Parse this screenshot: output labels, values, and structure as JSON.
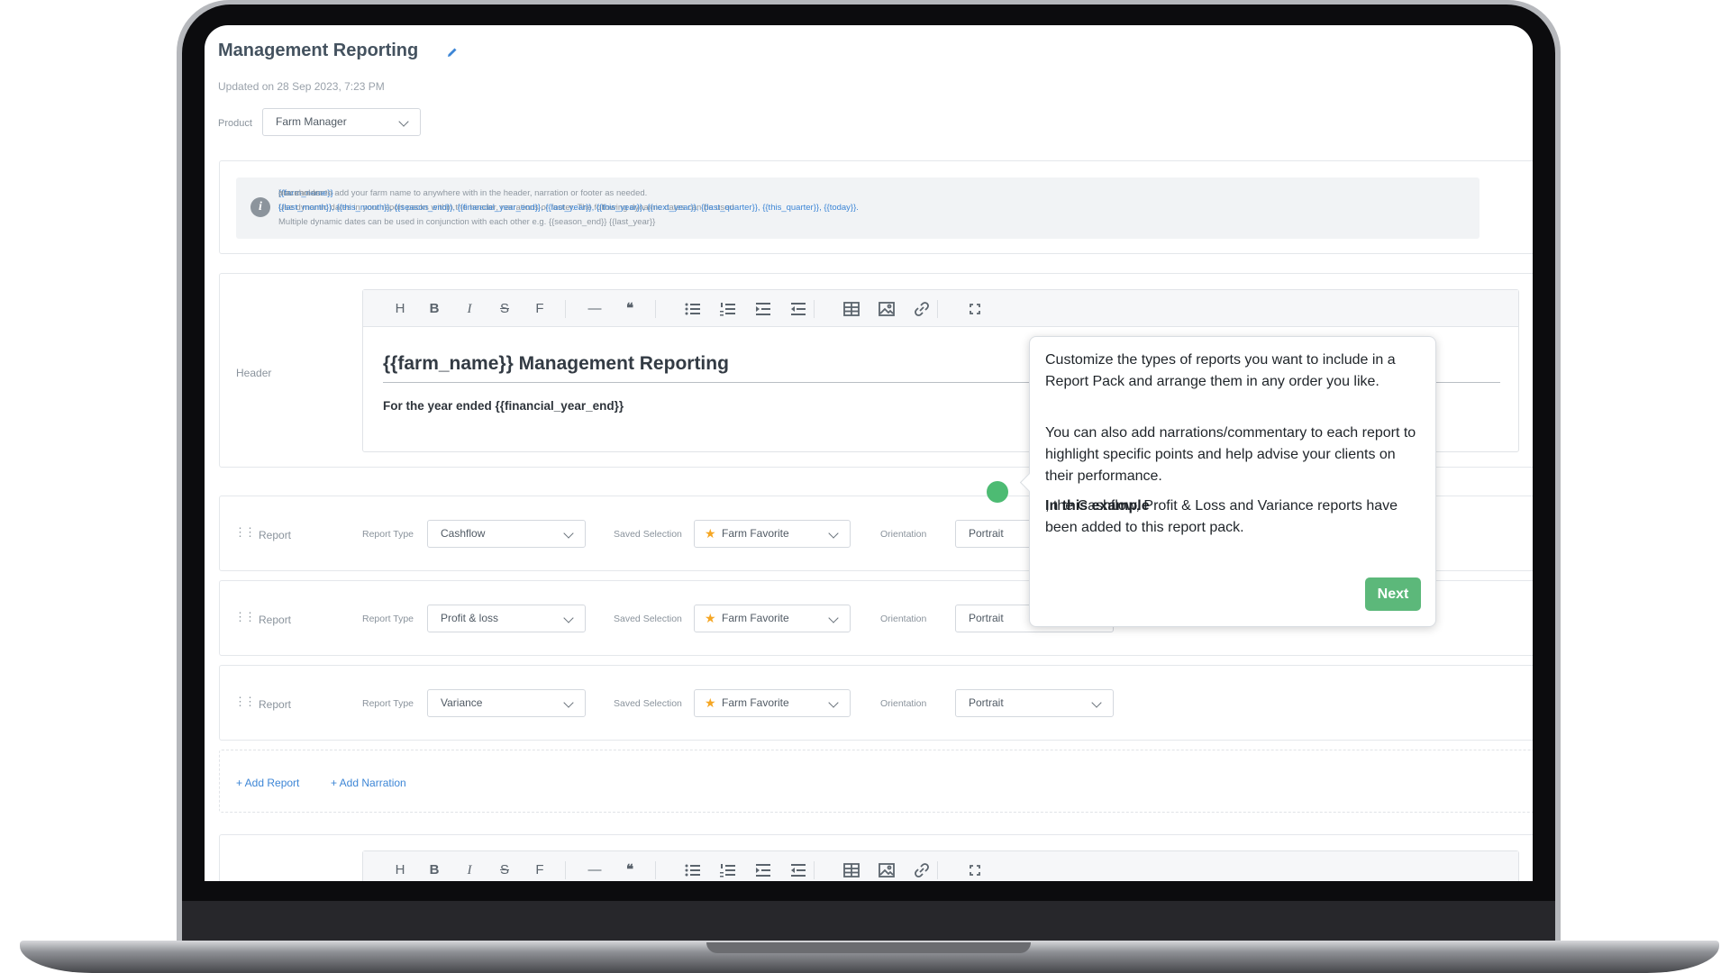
{
  "page": {
    "title": "Management Reporting",
    "updated": "Updated on 28 Sep 2023, 7:23 PM",
    "product_label": "Product",
    "product_value": "Farm Manager"
  },
  "info": {
    "line1_a": "You can use ",
    "line1_ph": "{{farm_name}}",
    "line1_b": " placeholder to add your farm name to anywhere with in the header, narration or footer as needed.",
    "line2_a": "Use dynamic dates in your report packs within the header, narrations or footer. The following dynamic dates can be used ",
    "line2_ph": "{{last_month}}, {{this_month}}, {{season_end}}, {{financial_year_end}}, {{last_year}}, {{this_year}}, {{next_year}}, {{last_quarter}}, {{this_quarter}}, {{today}}.",
    "line3": "Multiple dynamic dates can be used in conjunction with each other e.g. {{season_end}} {{last_year}}"
  },
  "header_section": {
    "label": "Header",
    "editor_title": "{{farm_name}} Management Reporting",
    "editor_subtitle": "For the year ended {{financial_year_end}}"
  },
  "toolbar": {
    "icons": [
      "heading-icon",
      "bold-icon",
      "italic-icon",
      "strikethrough-icon",
      "font-icon",
      "horizontal-rule-icon",
      "quote-icon",
      "bullet-list-icon",
      "numbered-list-icon",
      "indent-icon",
      "outdent-icon",
      "table-icon",
      "image-icon",
      "link-icon",
      "fullscreen-icon"
    ],
    "heading": "H",
    "bold": "B",
    "italic": "I",
    "strike": "S",
    "font": "F",
    "rule": "—",
    "quote": "❝"
  },
  "reports": [
    {
      "label": "Report",
      "type_label": "Report Type",
      "type_value": "Cashflow",
      "selection_label": "Saved Selection",
      "selection_value": "Farm Favorite",
      "orientation_label": "Orientation",
      "orientation_value": "Portrait"
    },
    {
      "label": "Report",
      "type_label": "Report Type",
      "type_value": "Profit & loss",
      "selection_label": "Saved Selection",
      "selection_value": "Farm Favorite",
      "orientation_label": "Orientation",
      "orientation_value": "Portrait"
    },
    {
      "label": "Report",
      "type_label": "Report Type",
      "type_value": "Variance",
      "selection_label": "Saved Selection",
      "selection_value": "Farm Favorite",
      "orientation_label": "Orientation",
      "orientation_value": "Portrait"
    }
  ],
  "actions": {
    "add_report": "+ Add Report",
    "add_narration": "+ Add Narration"
  },
  "tooltip": {
    "p1": "Customize the types of reports you want to include in a Report Pack and arrange them in any order you like.",
    "p2": "You can also add narrations/commentary to each report to highlight specific points and help advise your clients on their performance.",
    "p3_bold": "In this example",
    "p3_rest": ", the Cashflow, Profit & Loss and Variance reports have been added to this report pack.",
    "next": "Next"
  },
  "colors": {
    "accent": "#3d86d6",
    "next_button": "#5cb87a",
    "star": "#f5a623"
  }
}
